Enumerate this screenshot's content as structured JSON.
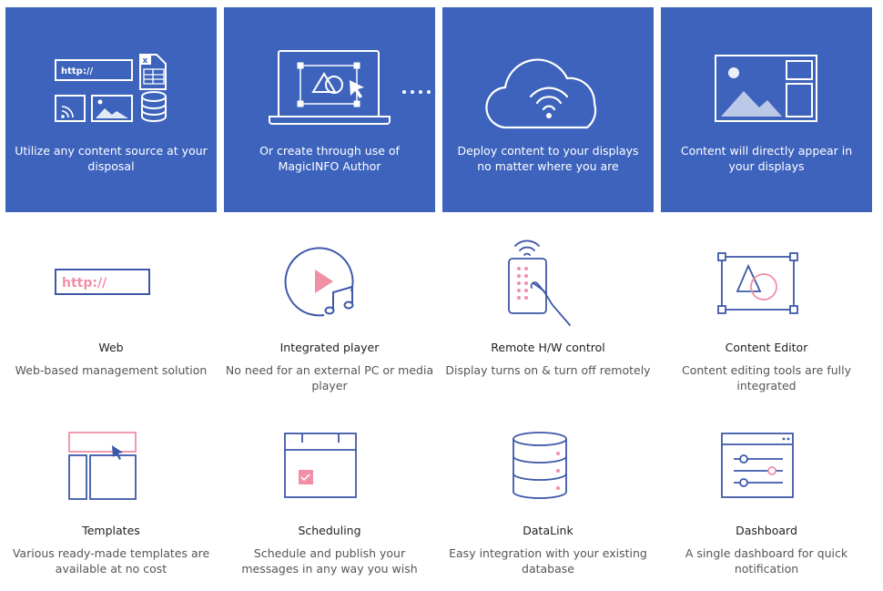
{
  "colors": {
    "card_bg": "#3d63bd",
    "icon_blue": "#3d58a8",
    "accent_pink": "#f08fa6"
  },
  "workflow": [
    {
      "icon": "content-sources-icon",
      "caption": "Utilize any content source at your disposal",
      "url_text": "http://",
      "file_badge": "x"
    },
    {
      "icon": "laptop-author-icon",
      "caption": "Or create through use of MagicINFO Author"
    },
    {
      "icon": "cloud-wifi-icon",
      "caption": "Deploy content to your displays no matter where you are"
    },
    {
      "icon": "display-layout-icon",
      "caption": "Content will directly appear in your displays"
    }
  ],
  "features": [
    {
      "icon": "web-url-icon",
      "title": "Web",
      "desc": "Web-based management solution",
      "url_text": "http://"
    },
    {
      "icon": "integrated-player-icon",
      "title": "Integrated player",
      "desc": "No need for an external PC or media player"
    },
    {
      "icon": "remote-control-icon",
      "title": "Remote H/W control",
      "desc": "Display turns on & turn off remotely"
    },
    {
      "icon": "content-editor-icon",
      "title": "Content Editor",
      "desc": "Content editing tools are fully integrated"
    },
    {
      "icon": "templates-icon",
      "title": "Templates",
      "desc": "Various ready-made templates are available at no cost"
    },
    {
      "icon": "scheduling-calendar-icon",
      "title": "Scheduling",
      "desc": "Schedule and publish your messages in any way you wish"
    },
    {
      "icon": "database-icon",
      "title": "DataLink",
      "desc": "Easy integration with your existing database"
    },
    {
      "icon": "dashboard-sliders-icon",
      "title": "Dashboard",
      "desc": "A single dashboard for quick notification"
    }
  ]
}
